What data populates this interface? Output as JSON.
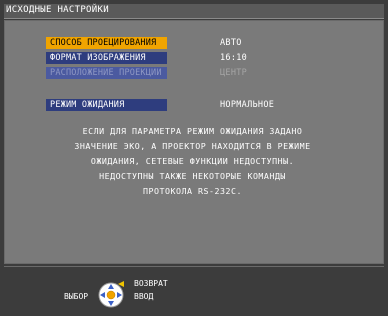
{
  "menu": {
    "title": "ИСХОДНЫЕ НАСТРОЙКИ",
    "items": [
      {
        "label": "СПОСОБ ПРОЕЦИРОВАНИЯ",
        "value": "АВТО"
      },
      {
        "label": "ФОРМАТ ИЗОБРАЖЕНИЯ",
        "value": "16:10"
      },
      {
        "label": "РАСПОЛОЖЕНИЕ ПРОЕКЦИИ",
        "value": "ЦЕНТР"
      },
      {
        "label": "РЕЖИМ ОЖИДАНИЯ",
        "value": "НОРМАЛЬНОЕ"
      }
    ]
  },
  "notice": {
    "lines": [
      "ЕСЛИ ДЛЯ ПАРАМЕТРА РЕЖИМ ОЖИДАНИЯ ЗАДАНО",
      "ЗНАЧЕНИЕ ЭКО, А ПРОЕКТОР НАХОДИТСЯ В РЕЖИМЕ",
      "ОЖИДАНИЯ, СЕТЕВЫЕ ФУНКЦИИ НЕДОСТУПНЫ.",
      "НЕДОСТУПНЫ ТАКЖЕ НЕКОТОРЫЕ КОМАНДЫ",
      "ПРОТОКОЛА RS-232C."
    ]
  },
  "footer": {
    "select": "ВЫБОР",
    "return": "ВОЗВРАТ",
    "enter": "ВВОД"
  },
  "colors": {
    "selected_bg": "#f0a400",
    "item_bg": "#2e3d7e",
    "disabled_bg": "#4b5aa0",
    "panel_bg": "#7a7a7a"
  },
  "icons": {
    "dpad": "directional-pad-icon"
  }
}
